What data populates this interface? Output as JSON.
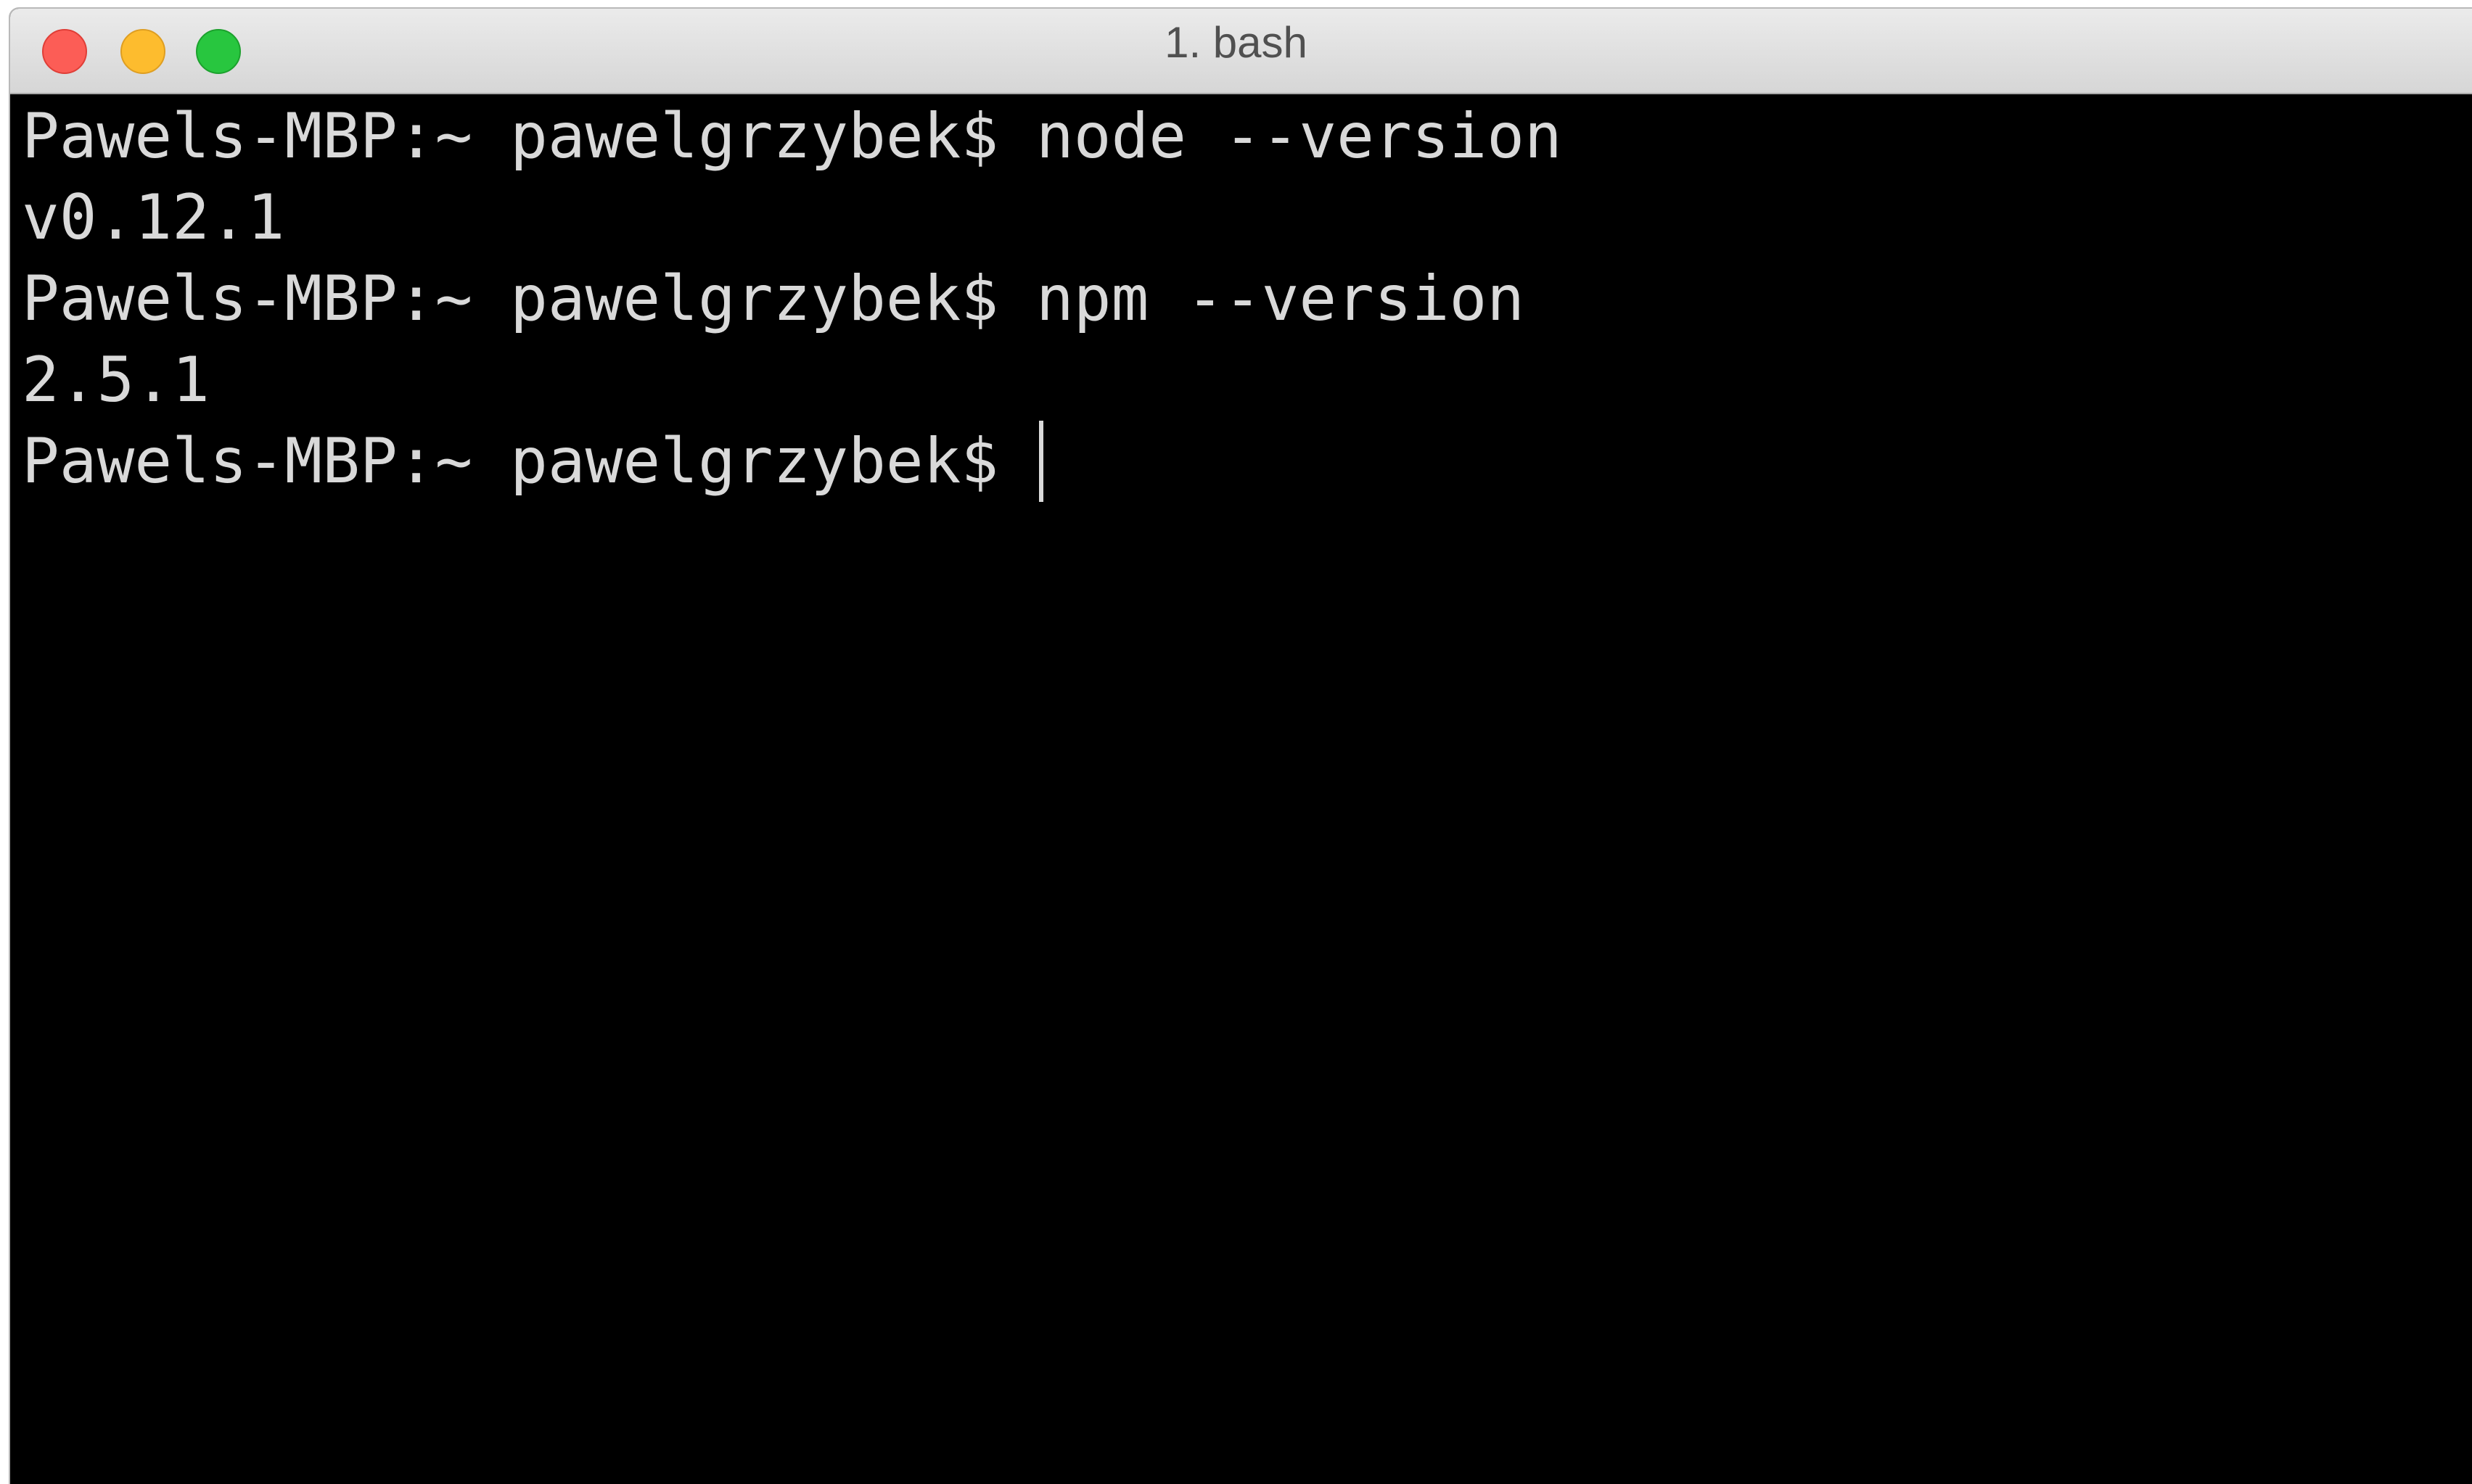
{
  "window": {
    "title": "1. bash",
    "buttons": {
      "close": "close-button",
      "minimize": "minimize-button",
      "zoom": "zoom-button"
    },
    "colors": {
      "close": "#fc5d56",
      "minimize": "#fdbc2e",
      "zoom": "#28c63f",
      "terminal_bg": "#000000",
      "terminal_text": "#d9d9d9"
    }
  },
  "terminal": {
    "lines": [
      "Pawels-MBP:~ pawelgrzybek$ node --version",
      "v0.12.1",
      "Pawels-MBP:~ pawelgrzybek$ npm --version",
      "2.5.1",
      "Pawels-MBP:~ pawelgrzybek$ "
    ]
  }
}
